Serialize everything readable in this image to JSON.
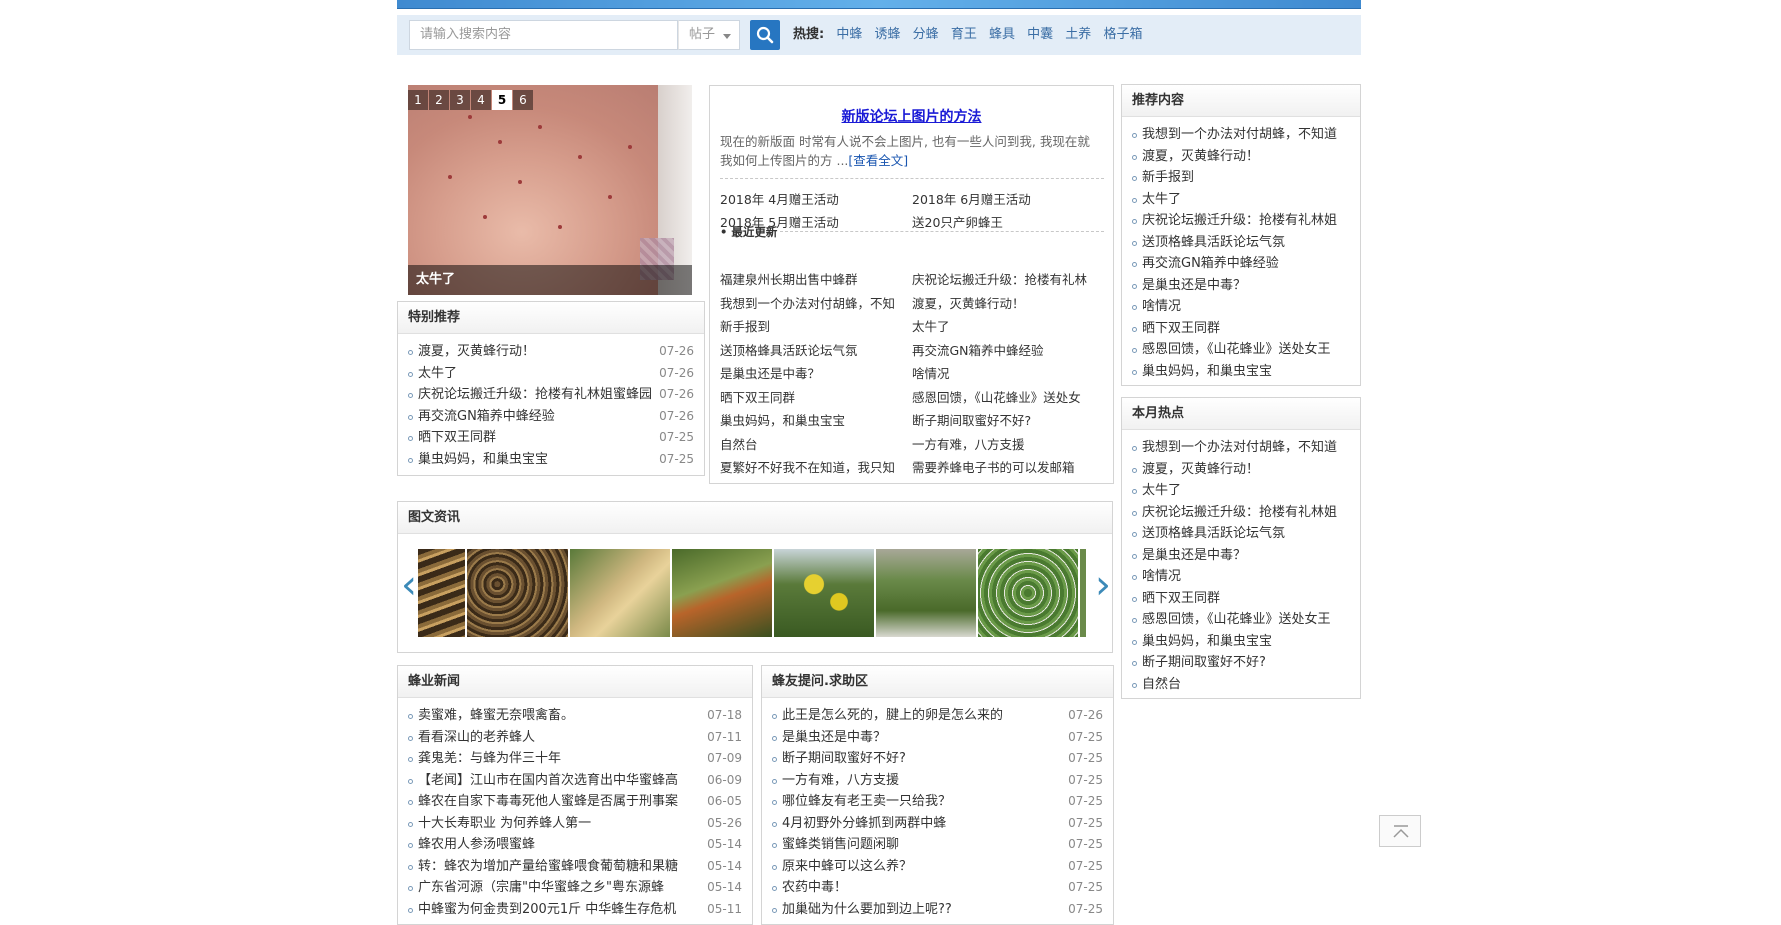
{
  "search": {
    "placeholder": "请输入搜索内容",
    "scope": "帖子",
    "hot_label": "热搜:",
    "hot_terms": [
      "中蜂",
      "诱蜂",
      "分蜂",
      "育王",
      "蜂具",
      "中囊",
      "土养",
      "格子箱"
    ]
  },
  "slideshow": {
    "numbers": [
      "1",
      "2",
      "3",
      "4",
      "5",
      "6"
    ],
    "active": "5",
    "caption": "太牛了"
  },
  "special": {
    "title": "特别推荐",
    "items": [
      {
        "t": "渡夏，灭黄蜂行动！",
        "d": "07-26"
      },
      {
        "t": "太牛了",
        "d": "07-26"
      },
      {
        "t": "庆祝论坛搬迁升级：抢楼有礼林姐蜜蜂园",
        "d": "07-26"
      },
      {
        "t": "再交流GN箱养中蜂经验",
        "d": "07-26"
      },
      {
        "t": "晒下双王同群",
        "d": "07-25"
      },
      {
        "t": "巢虫妈妈，和巢虫宝宝",
        "d": "07-25"
      }
    ]
  },
  "article": {
    "title": "新版论坛上图片的方法",
    "desc": "现在的新版面 时常有人说不会上图片, 也有一些人问到我, 我现在就我如何上传图片的方 ...",
    "more": "[查看全文]",
    "links": [
      "2018年 4月赠王活动",
      "2018年 6月赠王活动",
      "2018年 5月赠王活动",
      "送20只产卵蜂王"
    ],
    "recent_label": "最近更新",
    "recent": [
      "福建泉州长期出售中蜂群",
      "庆祝论坛搬迁升级：抢楼有礼林",
      "我想到一个办法对付胡蜂，不知",
      "渡夏，灭黄蜂行动！",
      "新手报到",
      "太牛了",
      "送顶格蜂具活跃论坛气氛",
      "再交流GN箱养中蜂经验",
      "是巢虫还是中毒？",
      "啥情况",
      "晒下双王同群",
      "感恩回馈，《山花蜂业》送处女",
      "巢虫妈妈，和巢虫宝宝",
      "断子期间取蜜好不好?",
      "自然台",
      "一方有难，八方支援",
      "夏繁好不好我不在知道，我只知",
      "需要养蜂电子书的可以发邮箱"
    ]
  },
  "recommend": {
    "title": "推荐内容",
    "items": [
      "我想到一个办法对付胡蜂，不知道",
      "渡夏，灭黄蜂行动！",
      "新手报到",
      "太牛了",
      "庆祝论坛搬迁升级：抢楼有礼林姐",
      "送顶格蜂具活跃论坛气氛",
      "再交流GN箱养中蜂经验",
      "是巢虫还是中毒？",
      "啥情况",
      "晒下双王同群",
      "感恩回馈，《山花蜂业》送处女王",
      "巢虫妈妈，和巢虫宝宝"
    ]
  },
  "hot_month": {
    "title": "本月热点",
    "items": [
      "我想到一个办法对付胡蜂，不知道",
      "渡夏，灭黄蜂行动！",
      "太牛了",
      "庆祝论坛搬迁升级：抢楼有礼林姐",
      "送顶格蜂具活跃论坛气氛",
      "是巢虫还是中毒？",
      "啥情况",
      "晒下双王同群",
      "感恩回馈，《山花蜂业》送处女王",
      "巢虫妈妈，和巢虫宝宝",
      "断子期间取蜜好不好?",
      "自然台"
    ]
  },
  "gallery": {
    "title": "图文资讯"
  },
  "news": {
    "title": "蜂业新闻",
    "items": [
      {
        "t": "卖蜜难，蜂蜜无奈喂禽畜。",
        "d": "07-18"
      },
      {
        "t": "看看深山的老养蜂人",
        "d": "07-11"
      },
      {
        "t": "龚鬼羌：与蜂为伴三十年",
        "d": "07-09"
      },
      {
        "t": "【老闻】江山市在国内首次选育出中华蜜蜂高",
        "d": "06-09"
      },
      {
        "t": "蜂农在自家下毒毒死他人蜜蜂是否属于刑事案",
        "d": "06-05"
      },
      {
        "t": "十大长寿职业 为何养蜂人第一",
        "d": "05-26"
      },
      {
        "t": "蜂农用人参汤喂蜜蜂",
        "d": "05-14"
      },
      {
        "t": "转：蜂农为增加产量给蜜蜂喂食葡萄糖和果糖",
        "d": "05-14"
      },
      {
        "t": "广东省河源（宗庸\"中华蜜蜂之乡\"粤东源蜂",
        "d": "05-14"
      },
      {
        "t": "中蜂蜜为何金贵到200元1斤 中华蜂生存危机",
        "d": "05-11"
      }
    ]
  },
  "qa": {
    "title": "蜂友提问.求助区",
    "items": [
      {
        "t": "此王是怎么死的，腱上的卵是怎么来的",
        "d": "07-26"
      },
      {
        "t": "是巢虫还是中毒？",
        "d": "07-25"
      },
      {
        "t": "断子期间取蜜好不好?",
        "d": "07-25"
      },
      {
        "t": "一方有难，八方支援",
        "d": "07-25"
      },
      {
        "t": "哪位蜂友有老王卖一只给我？",
        "d": "07-25"
      },
      {
        "t": "4月初野外分蜂抓到两群中蜂",
        "d": "07-25"
      },
      {
        "t": "蜜蜂类销售问题闲聊",
        "d": "07-25"
      },
      {
        "t": "原来中蜂可以这么养？",
        "d": "07-25"
      },
      {
        "t": "农药中毒！",
        "d": "07-25"
      },
      {
        "t": "加巢础为什么要加到边上呢??",
        "d": "07-25"
      }
    ]
  },
  "colors": {
    "accent": "#2776c1",
    "link": "#3b6ea5",
    "title_link": "#1a1ad6"
  }
}
